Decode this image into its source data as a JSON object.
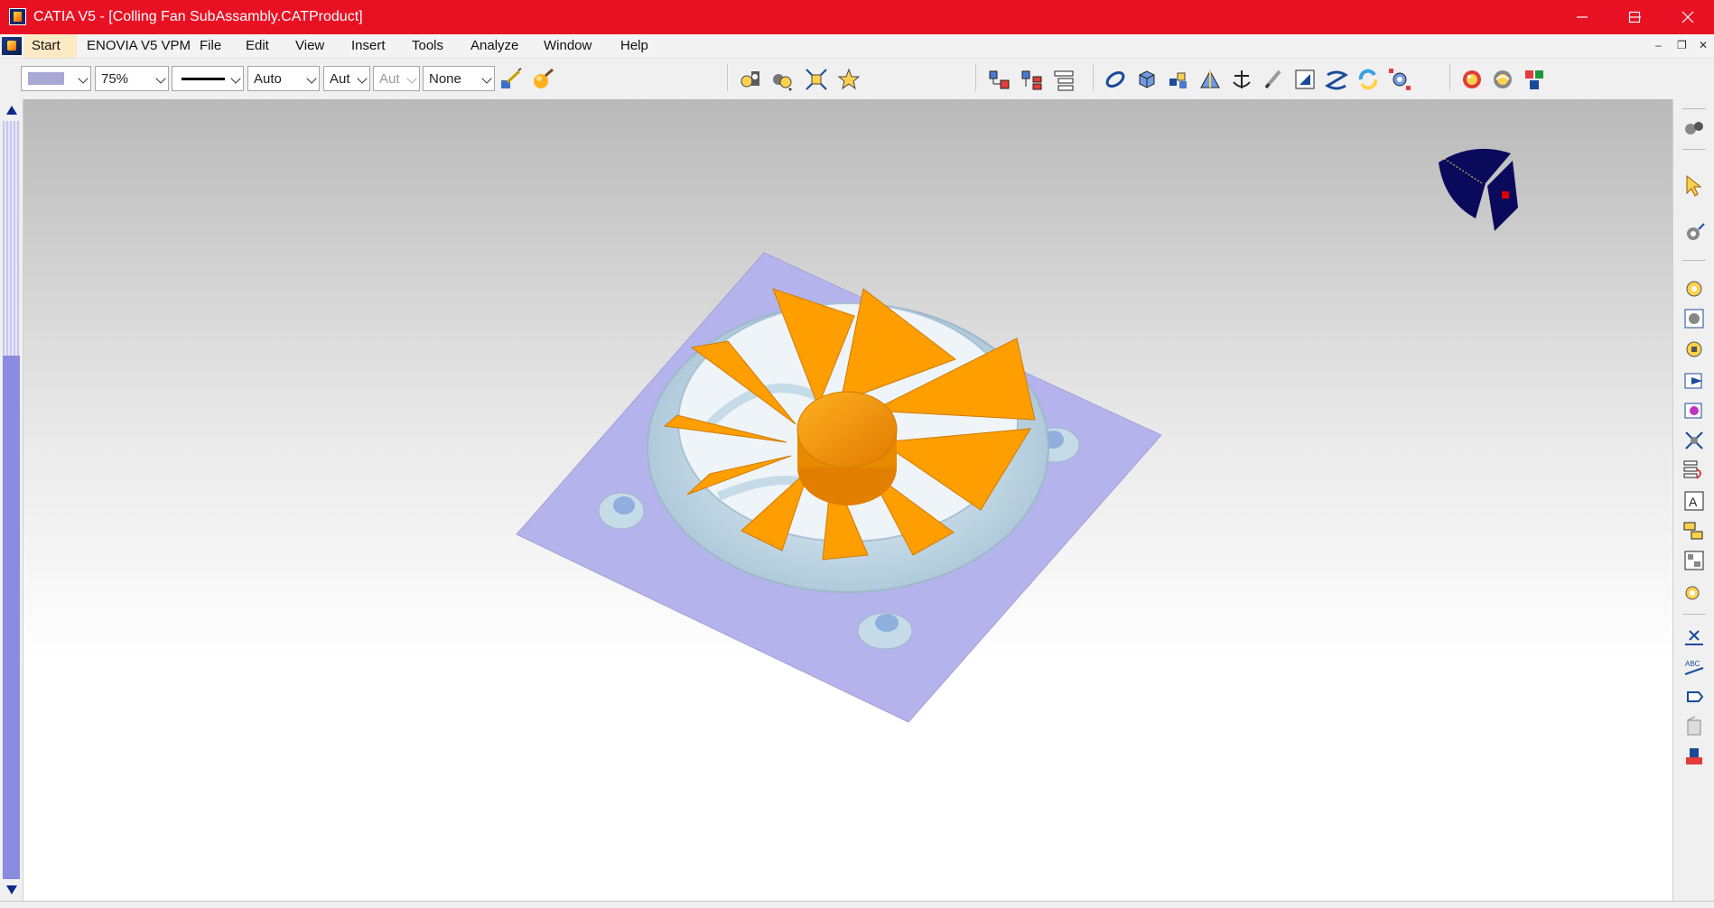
{
  "window": {
    "title": "CATIA V5 - [Colling Fan SubAssambly.CATProduct]",
    "controls": [
      "minimize-icon",
      "maximize-icon",
      "close-icon"
    ]
  },
  "menubar": {
    "items": [
      {
        "label": "Start"
      },
      {
        "label": "ENOVIA V5 VPM"
      },
      {
        "label": "File"
      },
      {
        "label": "Edit"
      },
      {
        "label": "View"
      },
      {
        "label": "Insert"
      },
      {
        "label": "Tools"
      },
      {
        "label": "Analyze"
      },
      {
        "label": "Window"
      },
      {
        "label": "Help"
      }
    ]
  },
  "toolbar": {
    "fill_color": "#a8a8d4",
    "transparency": "75%",
    "line_weight": "Auto",
    "layer_auto": "Aut",
    "layer_auto_disabled": "Aut",
    "layer": "None"
  },
  "colors": {
    "titlebar": "#e81123",
    "fan_orange": "#ff9e00",
    "frame_blue": "#c6dbe8",
    "plate_lavender": "#b4b3ec",
    "compass_navy": "#0a0a5c"
  },
  "icons": {
    "toolbar": [
      "brush-icon",
      "sphere-icon",
      "fly-icon",
      "fan-gear-icon",
      "fit-all-icon",
      "star-icon",
      "tree-icon",
      "tree2-icon",
      "tree3-icon",
      "link-icon",
      "cube-icon",
      "cubes-icon",
      "axis-icon",
      "anchor-icon",
      "pen-icon",
      "measure-icon",
      "rope-icon",
      "refresh-icon",
      "gear-grid-icon",
      "render-icon",
      "sphere2-icon",
      "shapes-icon"
    ],
    "rightbar": [
      "gears-icon",
      "select-arrow-icon",
      "gear-edit-icon",
      "gear-icon",
      "gear-box-icon",
      "gear-list-icon",
      "arrow-box-icon",
      "gear-move-icon",
      "gear-cross-icon",
      "tree-red-icon",
      "text-icon",
      "table-icon",
      "yellow-tree-icon",
      "gear-n-icon",
      "x-axis-icon",
      "abc-icon",
      "flag-icon",
      "stamp-icon",
      "paint-icon"
    ]
  }
}
